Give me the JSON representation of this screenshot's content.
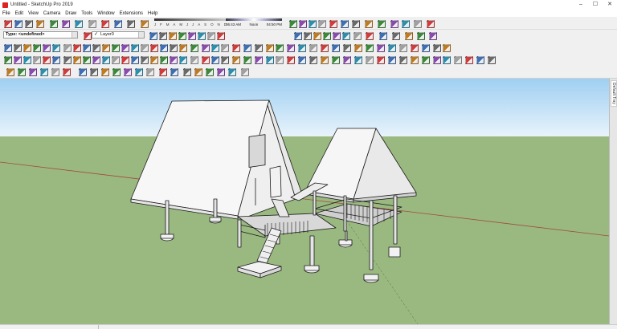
{
  "window": {
    "title": "Untitled - SketchUp Pro 2019",
    "minimize": "–",
    "maximize": "☐",
    "close": "✕"
  },
  "menu": [
    "File",
    "Edit",
    "View",
    "Camera",
    "Draw",
    "Tools",
    "Window",
    "Extensions",
    "Help"
  ],
  "shadow_settings": {
    "months": [
      "J",
      "F",
      "M",
      "A",
      "M",
      "J",
      "J",
      "A",
      "S",
      "O",
      "N",
      "D"
    ],
    "time_start": "06:43 AM",
    "time_noon": "Noon",
    "time_end": "04:50 PM"
  },
  "entity_info": {
    "type_label": "Type: <undefined>"
  },
  "layer": {
    "name": "Layer0",
    "check": "✓"
  },
  "tray": {
    "tab_label": "Default Tray"
  },
  "colors": {
    "sky_top": "#9fcff2",
    "sky_bottom": "#e8f3fb",
    "ground": "#9ab981",
    "axis_red": "#a34a3f",
    "model_face": "#f5f5f5",
    "model_edge": "#1a1a1a"
  },
  "icons": [
    "sketchup-logo-icon",
    "save-icon",
    "open-icon",
    "cut-icon",
    "copy-icon",
    "paste-icon",
    "erase-icon",
    "undo-icon",
    "redo-icon",
    "print-icon",
    "model-info-icon",
    "select-icon",
    "eraser-icon",
    "paint-icon",
    "line-icon",
    "arc-icon",
    "rectangle-icon",
    "pushpull-icon",
    "move-icon",
    "rotate-icon",
    "scale-icon",
    "offset-icon",
    "tape-icon",
    "text-icon",
    "axes-icon",
    "orbit-icon",
    "pan-icon",
    "zoom-icon",
    "zoom-extents-icon",
    "warehouse-icon",
    "extension-warehouse-icon",
    "layout-icon",
    "gear-icon"
  ]
}
